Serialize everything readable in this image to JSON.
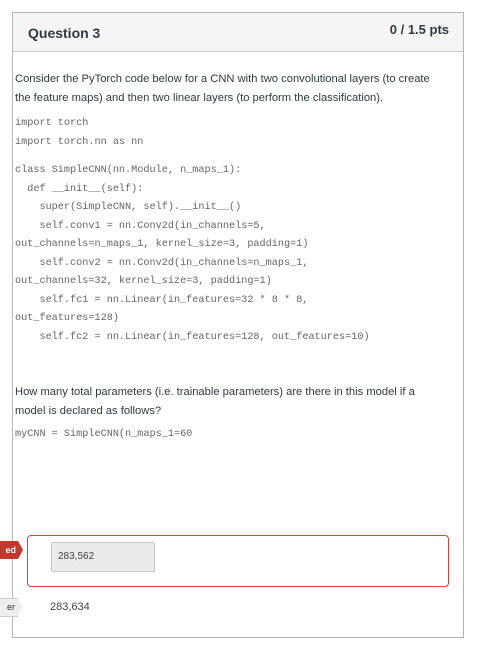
{
  "question": {
    "title": "Question 3",
    "points": "0 / 1.5 pts"
  },
  "prompt": "Consider the PyTorch code below for a CNN with two convolutional layers (to create the feature maps) and then two linear layers (to perform the classification).",
  "code_imports": [
    "import torch",
    "import torch.nn as nn"
  ],
  "code_class": [
    "class SimpleCNN(nn.Module, n_maps_1):",
    "  def __init__(self):",
    "    super(SimpleCNN, self).__init__()",
    "    self.conv1 = nn.Conv2d(in_channels=5,",
    "out_channels=n_maps_1, kernel_size=3, padding=1)",
    "    self.conv2 = nn.Conv2d(in_channels=n_maps_1,",
    "out_channels=32, kernel_size=3, padding=1)",
    "    self.fc1 = nn.Linear(in_features=32 * 8 * 8,",
    "out_features=128)",
    "    self.fc2 = nn.Linear(in_features=128, out_features=10)"
  ],
  "question_text": "How many total parameters (i.e. trainable parameters) are there in this model if a model is declared as follows?",
  "declaration": "myCNN = SimpleCNN(n_maps_1=60",
  "your_answer_tag": "ed",
  "your_answer": "283,562",
  "correct_answer_tag": "er",
  "correct_answer": "283,634",
  "colors": {
    "incorrect": "#d9442f",
    "header_bg": "#f5f5f5"
  }
}
